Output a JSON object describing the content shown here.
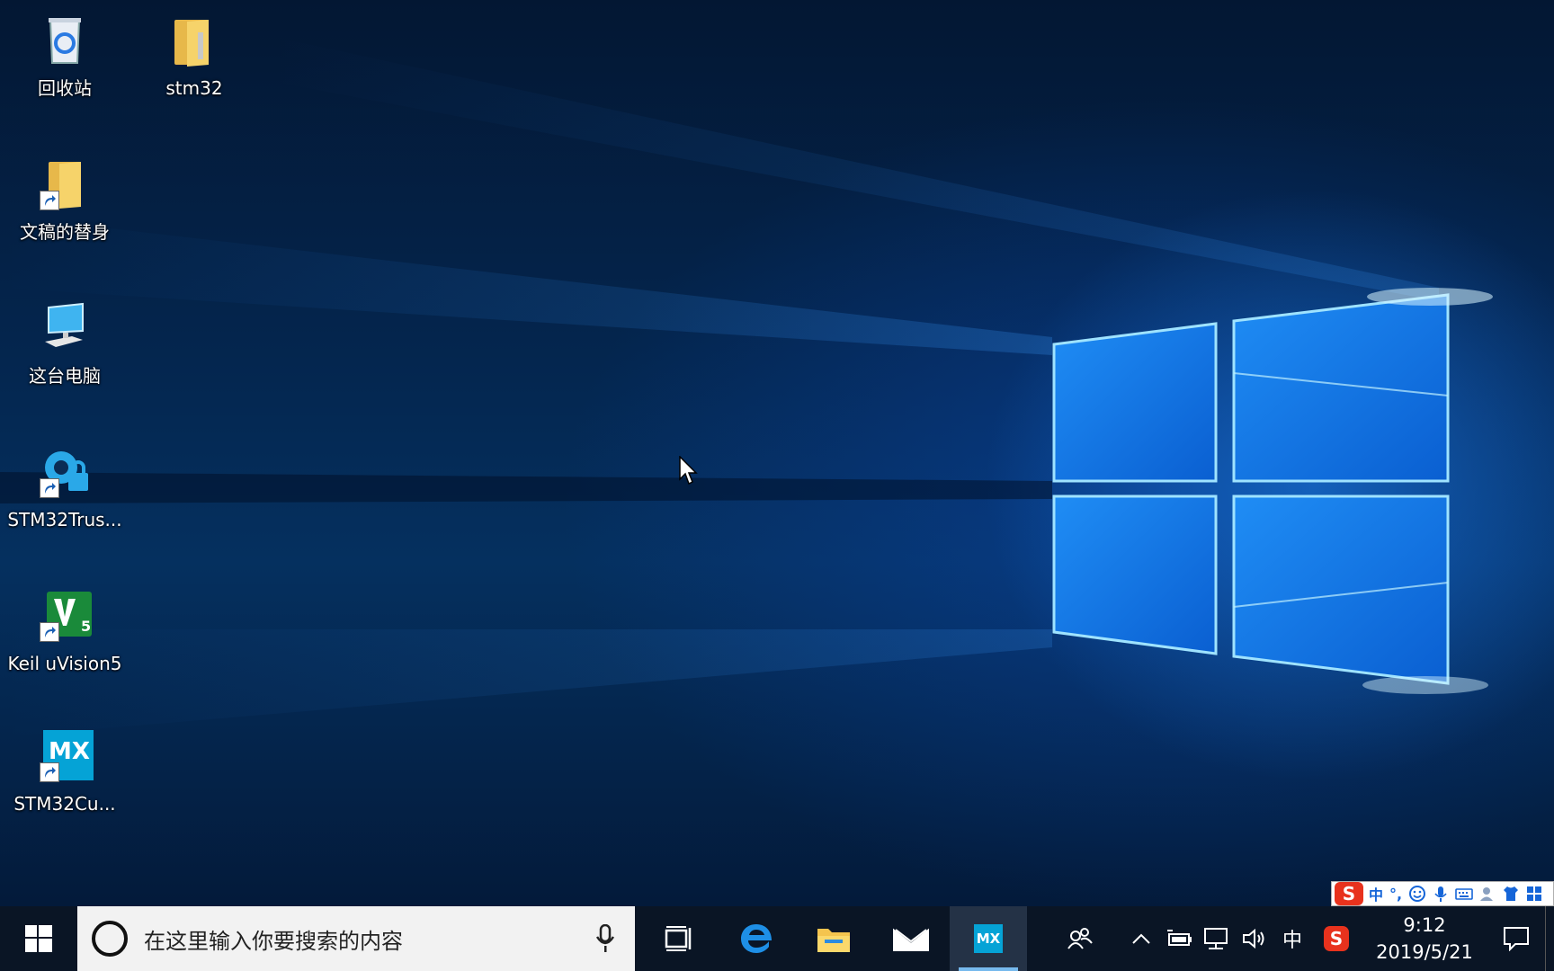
{
  "desktop": {
    "icons": [
      {
        "label": "回收站",
        "icon": "recycle-bin-icon",
        "shortcut": false
      },
      {
        "label": "stm32",
        "icon": "folder-icon",
        "shortcut": false
      },
      {
        "label": "文稿的替身",
        "icon": "folder-icon",
        "shortcut": true
      },
      {
        "label": "这台电脑",
        "icon": "computer-icon",
        "shortcut": false
      },
      {
        "label": "STM32Trus...",
        "icon": "stm32-trust-icon",
        "shortcut": true
      },
      {
        "label": "Keil uVision5",
        "icon": "keil-uvision-icon",
        "shortcut": true
      },
      {
        "label": "STM32Cu...",
        "icon": "stm32cubemx-icon",
        "shortcut": true
      }
    ]
  },
  "ime_bar": {
    "items": [
      "中",
      "°,"
    ],
    "logo_letter": "S"
  },
  "taskbar": {
    "search_placeholder": "在这里输入你要搜索的内容",
    "pinned": [
      {
        "name": "task-view",
        "icon": "task-view-icon"
      },
      {
        "name": "edge",
        "icon": "edge-icon"
      },
      {
        "name": "file-explorer",
        "icon": "folder-icon"
      },
      {
        "name": "mail",
        "icon": "mail-icon"
      },
      {
        "name": "stm32cubemx",
        "icon": "stm32cubemx-icon",
        "active": true,
        "label": "MX"
      }
    ],
    "tray": {
      "ime_mode": "中",
      "clock_time": "9:12",
      "clock_date": "2019/5/21"
    }
  },
  "colors": {
    "accent": "#0078d7",
    "taskbar_bg": "#0a1525",
    "search_bg": "#f2f2f2",
    "sogou_red": "#e8321d",
    "mx_cyan": "#05a3d6"
  }
}
